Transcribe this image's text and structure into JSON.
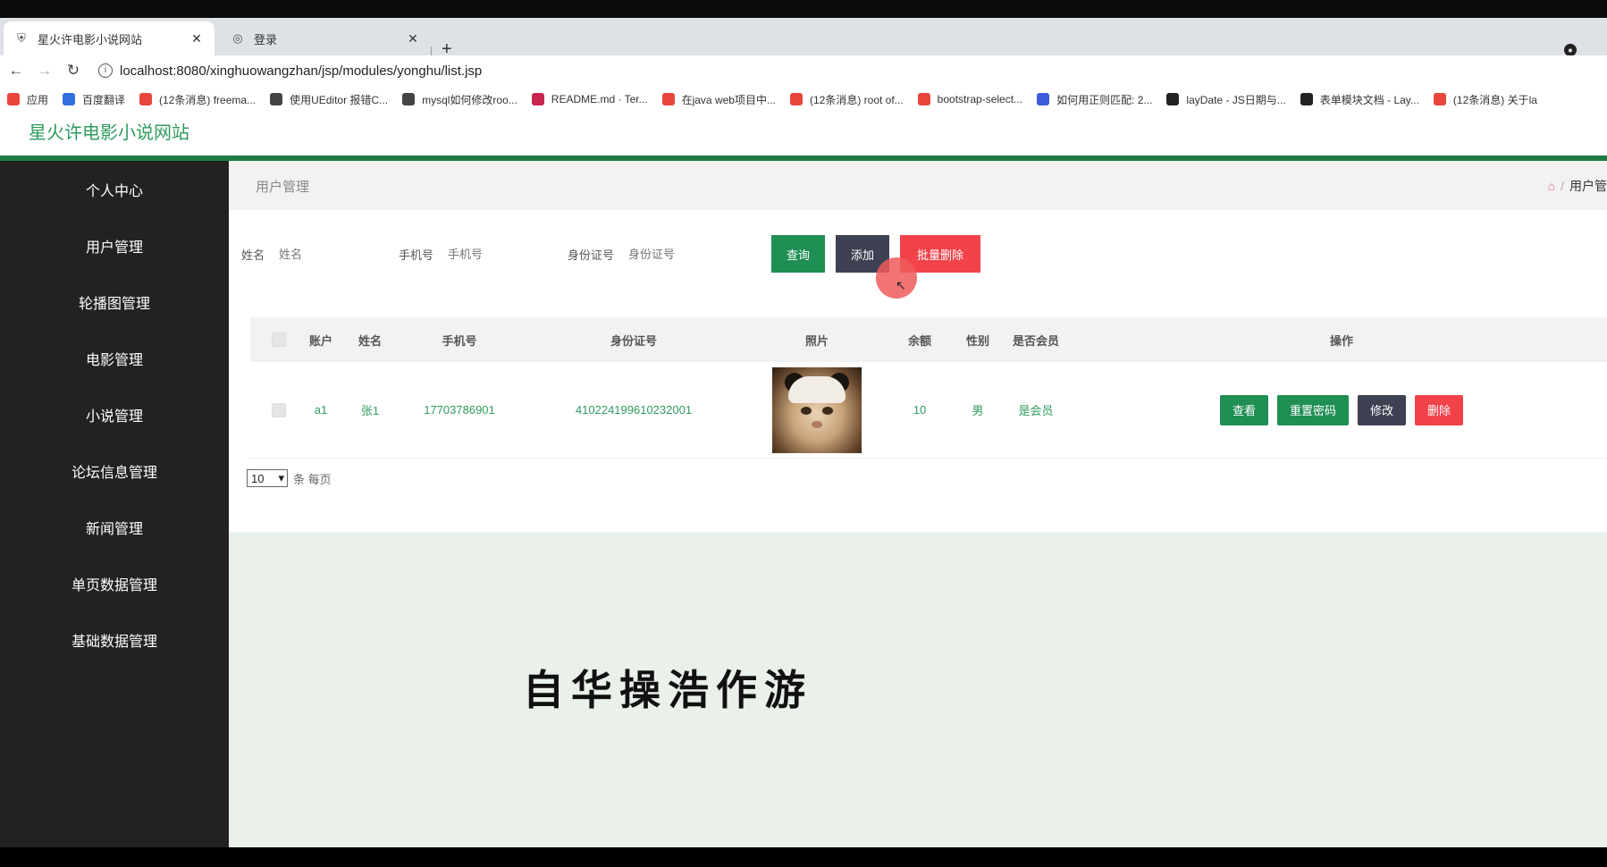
{
  "browser": {
    "tabs": [
      {
        "label": "星火许电影小说网站",
        "icon": "shield-icon",
        "active": true
      },
      {
        "label": "登录",
        "icon": "globe-icon",
        "active": false
      }
    ],
    "new_tab": "+",
    "url": "localhost:8080/xinghuowangzhan/jsp/modules/yonghu/list.jsp",
    "bookmarks": [
      {
        "label": "应用",
        "icon_color": "#e8453c"
      },
      {
        "label": "百度翻译",
        "icon_color": "#2f6fe0"
      },
      {
        "label": "(12条消息) freema...",
        "icon_color": "#e8453c"
      },
      {
        "label": "使用UEditor 报错C...",
        "icon_color": "#444444"
      },
      {
        "label": "mysql如何修改roo...",
        "icon_color": "#444444"
      },
      {
        "label": "README.md · Ter...",
        "icon_color": "#c7254e"
      },
      {
        "label": "在java web项目中...",
        "icon_color": "#e8453c"
      },
      {
        "label": "(12条消息) root of...",
        "icon_color": "#e8453c"
      },
      {
        "label": "bootstrap-select...",
        "icon_color": "#e8453c"
      },
      {
        "label": "如何用正则匹配: 2...",
        "icon_color": "#3b5bdb"
      },
      {
        "label": "layDate - JS日期与...",
        "icon_color": "#222222"
      },
      {
        "label": "表单模块文档 - Lay...",
        "icon_color": "#222222"
      },
      {
        "label": "(12条消息) 关于la",
        "icon_color": "#e8453c"
      }
    ]
  },
  "site": {
    "title": "星火许电影小说网站",
    "accent": "#2e9b5e"
  },
  "sidebar": {
    "items": [
      {
        "label": "个人中心"
      },
      {
        "label": "用户管理"
      },
      {
        "label": "轮播图管理"
      },
      {
        "label": "电影管理"
      },
      {
        "label": "小说管理"
      },
      {
        "label": "论坛信息管理"
      },
      {
        "label": "新闻管理"
      },
      {
        "label": "单页数据管理"
      },
      {
        "label": "基础数据管理"
      }
    ]
  },
  "main": {
    "breadcrumb_title": "用户管理",
    "breadcrumb_right": "用户管",
    "search": {
      "name_label": "姓名",
      "name_placeholder": "姓名",
      "phone_label": "手机号",
      "phone_placeholder": "手机号",
      "id_label": "身份证号",
      "id_placeholder": "身份证号",
      "query_btn": "查询",
      "add_btn": "添加",
      "batch_delete_btn": "批量删除"
    },
    "table": {
      "headers": [
        "账户",
        "姓名",
        "手机号",
        "身份证号",
        "照片",
        "余额",
        "性别",
        "是否会员",
        "操作"
      ],
      "rows": [
        {
          "account": "a1",
          "name": "张1",
          "phone": "17703786901",
          "id_number": "410224199610232001",
          "balance": "10",
          "sex": "男",
          "member": "是会员",
          "ops": {
            "view": "查看",
            "reset": "重置密码",
            "edit": "修改",
            "delete": "删除"
          }
        }
      ]
    },
    "pager": {
      "page_size": "10",
      "suffix": "条 每页"
    },
    "bottom_text": "自华操浩作游"
  }
}
